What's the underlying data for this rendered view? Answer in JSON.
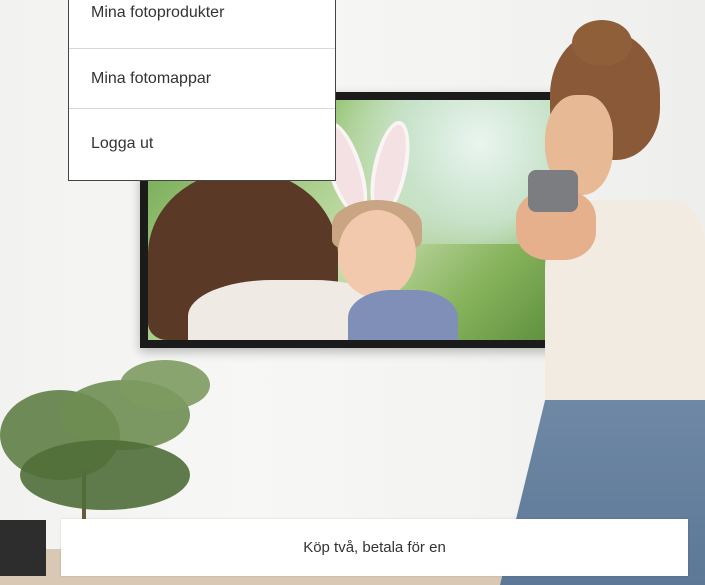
{
  "menu": {
    "items": [
      {
        "label": "Mina fotoprodukter"
      },
      {
        "label": "Mina fotomappar"
      },
      {
        "label": "Logga ut"
      }
    ]
  },
  "promo": {
    "label": "Köp två, betala för en"
  },
  "colors": {
    "menu_border": "#444444",
    "text": "#333333",
    "dark_block": "#2d2d2d"
  }
}
